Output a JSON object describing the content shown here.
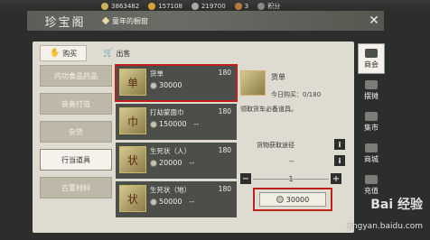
{
  "topbar": {
    "currencies": [
      {
        "icon": "ingot-icon",
        "value": "3863482"
      },
      {
        "icon": "coin-icon",
        "value": "157108"
      },
      {
        "icon": "silver-icon",
        "value": "219700"
      },
      {
        "icon": "token-icon",
        "value": "3"
      },
      {
        "icon": "points-icon",
        "value": "积分"
      }
    ]
  },
  "header": {
    "title": "珍宝阁",
    "breadcrumb": "童年的橱窗",
    "close": "✕"
  },
  "tabs": [
    {
      "label": "购买",
      "icon": "hand-icon"
    },
    {
      "label": "出售",
      "icon": "cart-icon"
    }
  ],
  "categories": [
    "内功食品药品",
    "装备打造",
    "杂货",
    "行当道具",
    "古董材料"
  ],
  "items": [
    {
      "name": "货单",
      "qty": "180",
      "price": "30000",
      "extra": "",
      "glyph": "单"
    },
    {
      "name": "打劫蒙面巾",
      "qty": "180",
      "price": "150000",
      "extra": "--",
      "glyph": "巾"
    },
    {
      "name": "生死状（人）",
      "qty": "180",
      "price": "20000",
      "extra": "--",
      "glyph": "状"
    },
    {
      "name": "生死状（地）",
      "qty": "180",
      "price": "50000",
      "extra": "--",
      "glyph": "状"
    }
  ],
  "detail": {
    "name": "货单",
    "today": "今日购买：0/180",
    "desc": "领取货车必备道具。",
    "source_label": "货物获取途径",
    "source_value": "--",
    "quantity": "1",
    "minus": "−",
    "plus": "+",
    "buy_price": "30000"
  },
  "rightnav": [
    {
      "label": "商会",
      "icon": "shop-icon"
    },
    {
      "label": "摆摊",
      "icon": "stall-icon"
    },
    {
      "label": "集市",
      "icon": "market-icon"
    },
    {
      "label": "商城",
      "icon": "mall-icon"
    },
    {
      "label": "充值",
      "icon": "recharge-icon"
    }
  ],
  "watermark": {
    "text": "Bai 经验",
    "url": "jingyan.baidu.com"
  },
  "colors": {
    "highlight": "#c0201a",
    "panel": "#dedbd1",
    "dark": "#4b4e49"
  }
}
